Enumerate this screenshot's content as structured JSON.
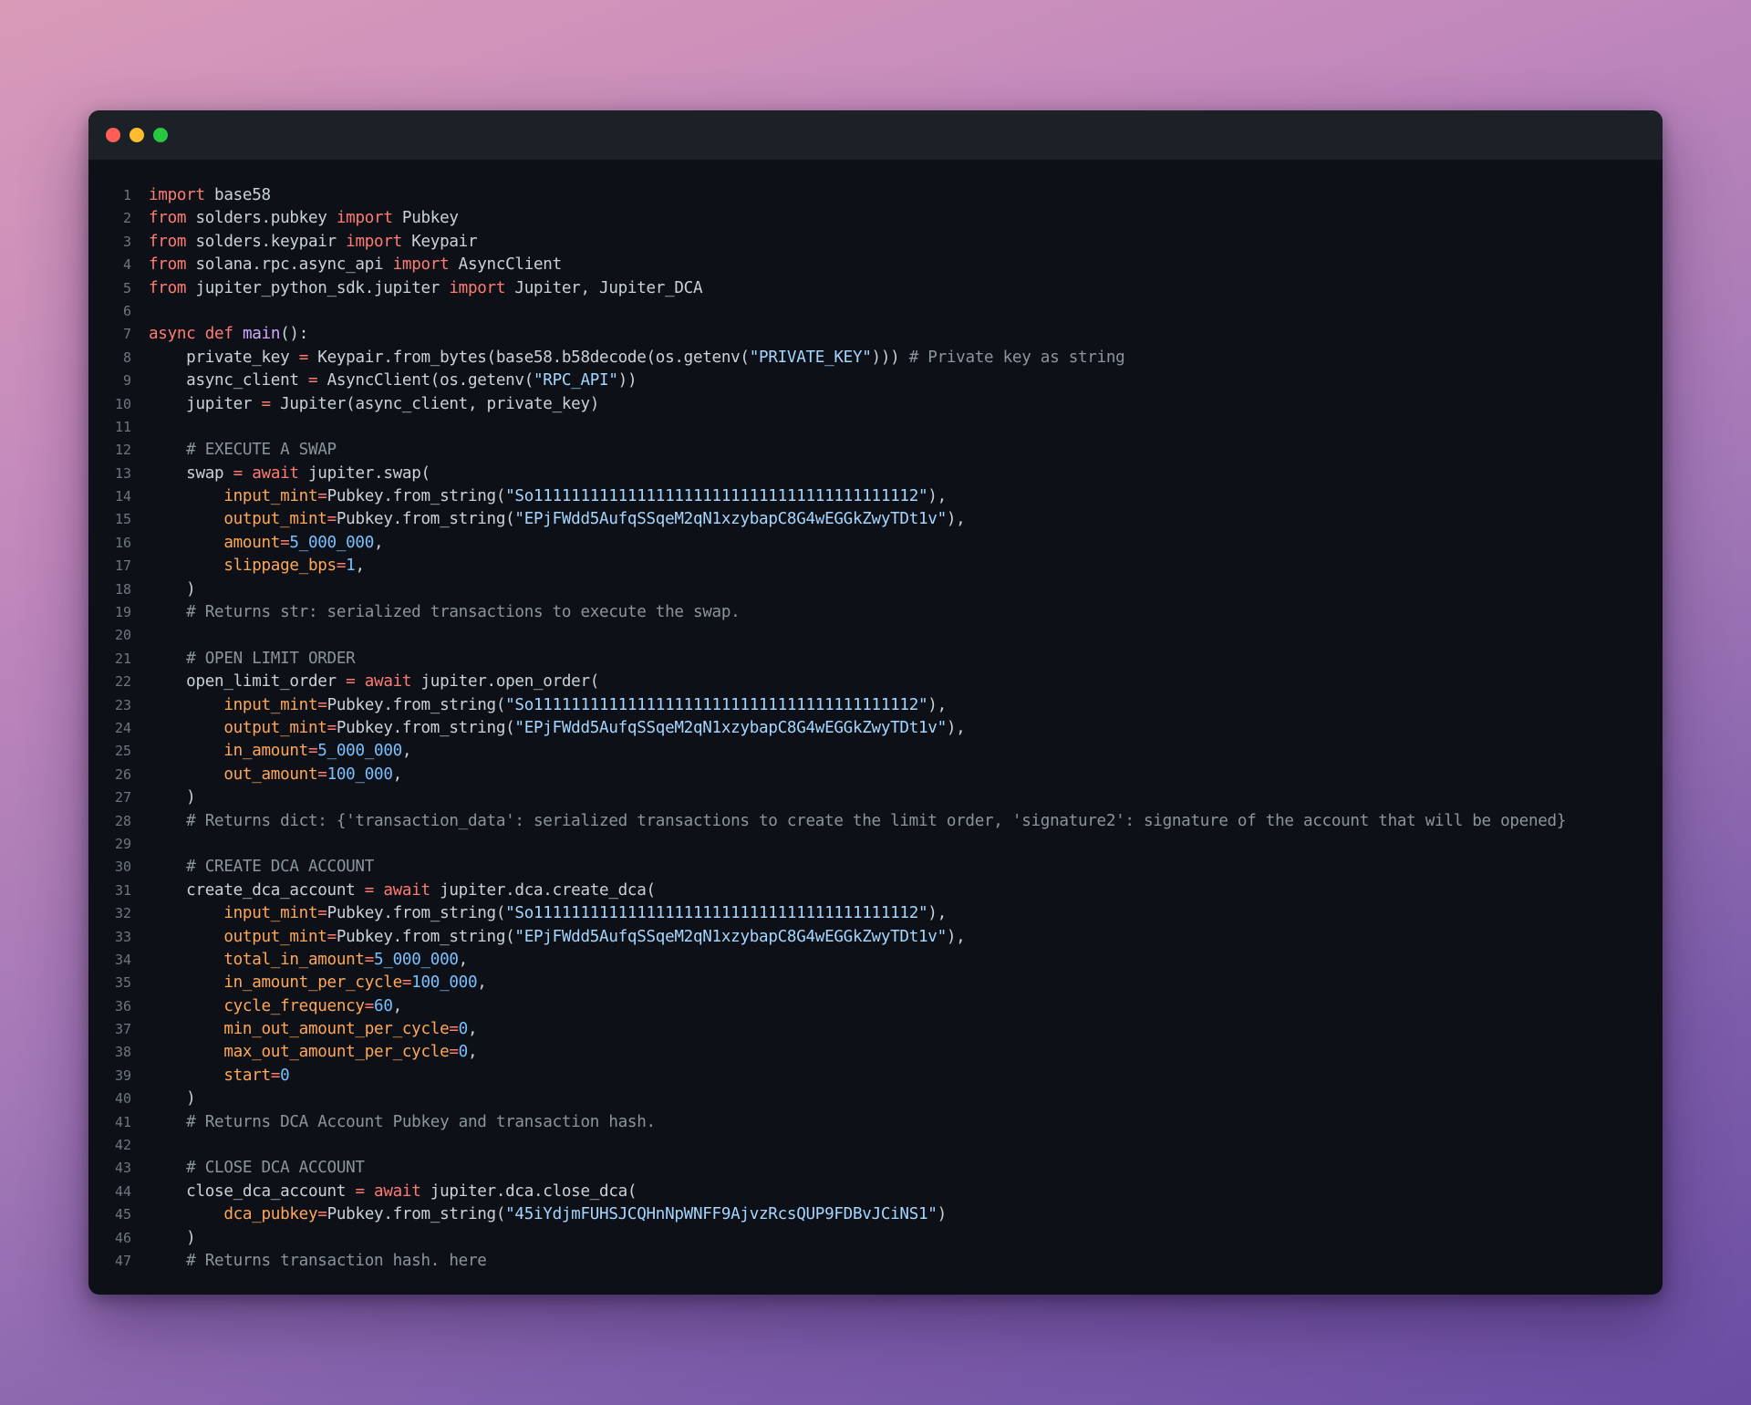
{
  "window": {
    "buttons": [
      "close",
      "minimize",
      "maximize"
    ]
  },
  "colors": {
    "keyword": "#ff7b72",
    "function": "#d2a8ff",
    "string": "#a5d6ff",
    "number": "#79c0ff",
    "argument": "#ffa657",
    "comment": "#8b949e",
    "plain": "#c9d1d9"
  },
  "code": {
    "lines": [
      [
        [
          "kw",
          "import"
        ],
        [
          "pl",
          " base58"
        ]
      ],
      [
        [
          "kw",
          "from"
        ],
        [
          "pl",
          " solders.pubkey "
        ],
        [
          "kw",
          "import"
        ],
        [
          "pl",
          " Pubkey"
        ]
      ],
      [
        [
          "kw",
          "from"
        ],
        [
          "pl",
          " solders.keypair "
        ],
        [
          "kw",
          "import"
        ],
        [
          "pl",
          " Keypair"
        ]
      ],
      [
        [
          "kw",
          "from"
        ],
        [
          "pl",
          " solana.rpc.async_api "
        ],
        [
          "kw",
          "import"
        ],
        [
          "pl",
          " AsyncClient"
        ]
      ],
      [
        [
          "kw",
          "from"
        ],
        [
          "pl",
          " jupiter_python_sdk.jupiter "
        ],
        [
          "kw",
          "import"
        ],
        [
          "pl",
          " Jupiter, Jupiter_DCA"
        ]
      ],
      [],
      [
        [
          "kw",
          "async def "
        ],
        [
          "fn",
          "main"
        ],
        [
          "pl",
          "():"
        ]
      ],
      [
        [
          "pl",
          "    private_key "
        ],
        [
          "kw",
          "="
        ],
        [
          "pl",
          " Keypair.from_bytes(base58.b58decode(os.getenv("
        ],
        [
          "str",
          "\"PRIVATE_KEY\""
        ],
        [
          "pl",
          "))) "
        ],
        [
          "cm",
          "# Private key as string"
        ]
      ],
      [
        [
          "pl",
          "    async_client "
        ],
        [
          "kw",
          "="
        ],
        [
          "pl",
          " AsyncClient(os.getenv("
        ],
        [
          "str",
          "\"RPC_API\""
        ],
        [
          "pl",
          "))"
        ]
      ],
      [
        [
          "pl",
          "    jupiter "
        ],
        [
          "kw",
          "="
        ],
        [
          "pl",
          " Jupiter(async_client, private_key)"
        ]
      ],
      [],
      [
        [
          "cm",
          "    # EXECUTE A SWAP"
        ]
      ],
      [
        [
          "pl",
          "    swap "
        ],
        [
          "kw",
          "="
        ],
        [
          "kw",
          " await"
        ],
        [
          "pl",
          " jupiter.swap("
        ]
      ],
      [
        [
          "arg",
          "        input_mint"
        ],
        [
          "kw",
          "="
        ],
        [
          "pl",
          "Pubkey.from_string("
        ],
        [
          "str",
          "\"So11111111111111111111111111111111111111112\""
        ],
        [
          "pl",
          "),"
        ]
      ],
      [
        [
          "arg",
          "        output_mint"
        ],
        [
          "kw",
          "="
        ],
        [
          "pl",
          "Pubkey.from_string("
        ],
        [
          "str",
          "\"EPjFWdd5AufqSSqeM2qN1xzybapC8G4wEGGkZwyTDt1v\""
        ],
        [
          "pl",
          "),"
        ]
      ],
      [
        [
          "arg",
          "        amount"
        ],
        [
          "kw",
          "="
        ],
        [
          "num",
          "5_000_000"
        ],
        [
          "pl",
          ","
        ]
      ],
      [
        [
          "arg",
          "        slippage_bps"
        ],
        [
          "kw",
          "="
        ],
        [
          "num",
          "1"
        ],
        [
          "pl",
          ","
        ]
      ],
      [
        [
          "pl",
          "    )"
        ]
      ],
      [
        [
          "cm",
          "    # Returns str: serialized transactions to execute the swap."
        ]
      ],
      [],
      [
        [
          "cm",
          "    # OPEN LIMIT ORDER"
        ]
      ],
      [
        [
          "pl",
          "    open_limit_order "
        ],
        [
          "kw",
          "="
        ],
        [
          "kw",
          " await"
        ],
        [
          "pl",
          " jupiter.open_order("
        ]
      ],
      [
        [
          "arg",
          "        input_mint"
        ],
        [
          "kw",
          "="
        ],
        [
          "pl",
          "Pubkey.from_string("
        ],
        [
          "str",
          "\"So11111111111111111111111111111111111111112\""
        ],
        [
          "pl",
          "),"
        ]
      ],
      [
        [
          "arg",
          "        output_mint"
        ],
        [
          "kw",
          "="
        ],
        [
          "pl",
          "Pubkey.from_string("
        ],
        [
          "str",
          "\"EPjFWdd5AufqSSqeM2qN1xzybapC8G4wEGGkZwyTDt1v\""
        ],
        [
          "pl",
          "),"
        ]
      ],
      [
        [
          "arg",
          "        in_amount"
        ],
        [
          "kw",
          "="
        ],
        [
          "num",
          "5_000_000"
        ],
        [
          "pl",
          ","
        ]
      ],
      [
        [
          "arg",
          "        out_amount"
        ],
        [
          "kw",
          "="
        ],
        [
          "num",
          "100_000"
        ],
        [
          "pl",
          ","
        ]
      ],
      [
        [
          "pl",
          "    )"
        ]
      ],
      [
        [
          "cm",
          "    # Returns dict: {'transaction_data': serialized transactions to create the limit order, 'signature2': signature of the account that will be opened}"
        ]
      ],
      [],
      [
        [
          "cm",
          "    # CREATE DCA ACCOUNT"
        ]
      ],
      [
        [
          "pl",
          "    create_dca_account "
        ],
        [
          "kw",
          "="
        ],
        [
          "kw",
          " await"
        ],
        [
          "pl",
          " jupiter.dca.create_dca("
        ]
      ],
      [
        [
          "arg",
          "        input_mint"
        ],
        [
          "kw",
          "="
        ],
        [
          "pl",
          "Pubkey.from_string("
        ],
        [
          "str",
          "\"So11111111111111111111111111111111111111112\""
        ],
        [
          "pl",
          "),"
        ]
      ],
      [
        [
          "arg",
          "        output_mint"
        ],
        [
          "kw",
          "="
        ],
        [
          "pl",
          "Pubkey.from_string("
        ],
        [
          "str",
          "\"EPjFWdd5AufqSSqeM2qN1xzybapC8G4wEGGkZwyTDt1v\""
        ],
        [
          "pl",
          "),"
        ]
      ],
      [
        [
          "arg",
          "        total_in_amount"
        ],
        [
          "kw",
          "="
        ],
        [
          "num",
          "5_000_000"
        ],
        [
          "pl",
          ","
        ]
      ],
      [
        [
          "arg",
          "        in_amount_per_cycle"
        ],
        [
          "kw",
          "="
        ],
        [
          "num",
          "100_000"
        ],
        [
          "pl",
          ","
        ]
      ],
      [
        [
          "arg",
          "        cycle_frequency"
        ],
        [
          "kw",
          "="
        ],
        [
          "num",
          "60"
        ],
        [
          "pl",
          ","
        ]
      ],
      [
        [
          "arg",
          "        min_out_amount_per_cycle"
        ],
        [
          "kw",
          "="
        ],
        [
          "num",
          "0"
        ],
        [
          "pl",
          ","
        ]
      ],
      [
        [
          "arg",
          "        max_out_amount_per_cycle"
        ],
        [
          "kw",
          "="
        ],
        [
          "num",
          "0"
        ],
        [
          "pl",
          ","
        ]
      ],
      [
        [
          "arg",
          "        start"
        ],
        [
          "kw",
          "="
        ],
        [
          "num",
          "0"
        ]
      ],
      [
        [
          "pl",
          "    )"
        ]
      ],
      [
        [
          "cm",
          "    # Returns DCA Account Pubkey and transaction hash."
        ]
      ],
      [],
      [
        [
          "cm",
          "    # CLOSE DCA ACCOUNT"
        ]
      ],
      [
        [
          "pl",
          "    close_dca_account "
        ],
        [
          "kw",
          "="
        ],
        [
          "kw",
          " await"
        ],
        [
          "pl",
          " jupiter.dca.close_dca("
        ]
      ],
      [
        [
          "arg",
          "        dca_pubkey"
        ],
        [
          "kw",
          "="
        ],
        [
          "pl",
          "Pubkey.from_string("
        ],
        [
          "str",
          "\"45iYdjmFUHSJCQHnNpWNFF9AjvzRcsQUP9FDBvJCiNS1\""
        ],
        [
          "pl",
          ")"
        ]
      ],
      [
        [
          "pl",
          "    )"
        ]
      ],
      [
        [
          "cm",
          "    # Returns transaction hash. here"
        ]
      ]
    ]
  }
}
